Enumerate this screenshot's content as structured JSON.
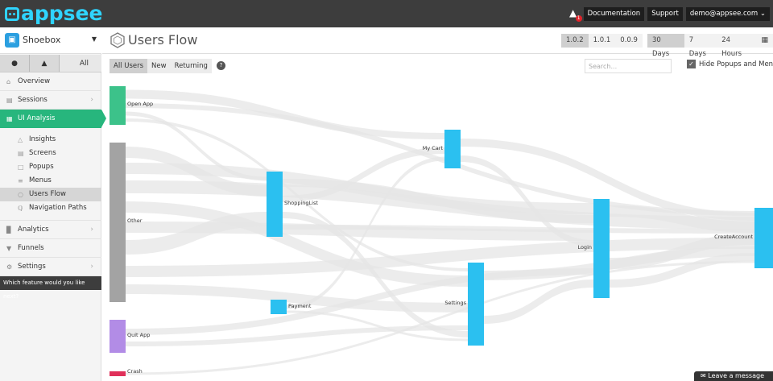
{
  "brand": {
    "name": "appsee",
    "color": "#2fd4ff"
  },
  "topbar": {
    "alert_count": "1",
    "documentation": "Documentation",
    "support": "Support",
    "user": "demo@appsee.com ⌄"
  },
  "sidebar": {
    "app_name": "Shoebox",
    "platforms": [
      "",
      "⬟",
      "All"
    ],
    "items": [
      {
        "label": "Overview",
        "icon": "home-icon"
      },
      {
        "label": "Sessions",
        "icon": "film-icon"
      },
      {
        "label": "UI Analysis",
        "icon": "grid-icon"
      }
    ],
    "sub_items": [
      {
        "label": "Insights",
        "icon": "flask-icon"
      },
      {
        "label": "Screens",
        "icon": "screen-icon"
      },
      {
        "label": "Popups",
        "icon": "popup-icon"
      },
      {
        "label": "Menus",
        "icon": "menu-icon"
      },
      {
        "label": "Users Flow",
        "icon": "flow-icon"
      },
      {
        "label": "Navigation Paths",
        "icon": "path-icon"
      }
    ],
    "bottom_items": [
      {
        "label": "Analytics",
        "icon": "bar-chart-icon"
      },
      {
        "label": "Funnels",
        "icon": "funnel-icon"
      },
      {
        "label": "Settings",
        "icon": "gear-icon"
      }
    ],
    "feedback": "Which feature would you like next?"
  },
  "header": {
    "title": "Users Flow",
    "versions": [
      "1.0.2",
      "1.0.1",
      "0.0.9"
    ],
    "ranges": [
      "30 Days",
      "7 Days",
      "24 Hours"
    ]
  },
  "filters": {
    "segments": [
      "All Users",
      "New",
      "Returning"
    ],
    "search_placeholder": "Search...",
    "hide_label": "Hide Popups and Menus"
  },
  "flow": {
    "colors": {
      "start": "#3cc28a",
      "other": "#a3a3a3",
      "screen": "#2bc0f0",
      "quit": "#b28ce6",
      "crash": "#e0305a",
      "link": "#e6e6e6"
    },
    "nodes": [
      {
        "label": "Open App",
        "kind": "start"
      },
      {
        "label": "Other",
        "kind": "other"
      },
      {
        "label": "Quit App",
        "kind": "quit"
      },
      {
        "label": "Crash",
        "kind": "crash"
      },
      {
        "label": "ShoppingList",
        "kind": "screen"
      },
      {
        "label": "Payment",
        "kind": "screen"
      },
      {
        "label": "My Cart",
        "kind": "screen"
      },
      {
        "label": "Settings",
        "kind": "screen"
      },
      {
        "label": "Login",
        "kind": "screen"
      },
      {
        "label": "CreateAccount",
        "kind": "screen"
      }
    ]
  },
  "chat": {
    "label": "Leave a message"
  }
}
